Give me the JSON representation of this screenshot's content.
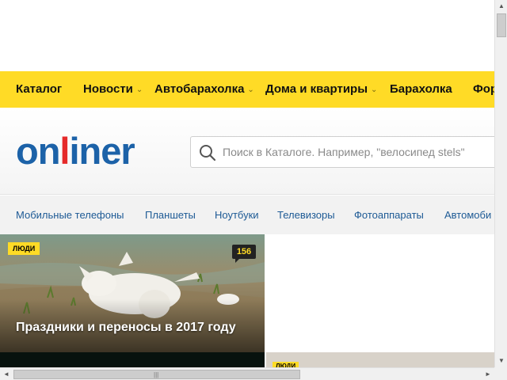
{
  "nav": {
    "items": [
      {
        "label": "Каталог",
        "has_dropdown": false
      },
      {
        "label": "Новости",
        "has_dropdown": true
      },
      {
        "label": "Автобарахолка",
        "has_dropdown": true
      },
      {
        "label": "Дома и квартиры",
        "has_dropdown": true
      },
      {
        "label": "Барахолка",
        "has_dropdown": false
      },
      {
        "label": "Фор",
        "has_dropdown": false
      }
    ],
    "dropdown_glyph": "⌄",
    "background_color": "#ffdb26"
  },
  "logo": {
    "part1": "on",
    "part2": "l",
    "part3": "iner",
    "color": "#1c62a8",
    "accent_color": "#e52a2a"
  },
  "search": {
    "placeholder": "Поиск в Каталоге. Например, \"велосипед stels\"",
    "icon": "search-icon"
  },
  "categories": [
    {
      "label": "Мобильные телефоны"
    },
    {
      "label": "Планшеты"
    },
    {
      "label": "Ноутбуки"
    },
    {
      "label": "Телевизоры"
    },
    {
      "label": "Фотоаппараты"
    },
    {
      "label": "Автомоби"
    }
  ],
  "news": {
    "main": {
      "tag": "ЛЮДИ",
      "comments": "156",
      "title": "Праздники и переносы в 2017 году"
    },
    "secondary": {
      "tag": "ЛЮДИ"
    }
  },
  "scrollbars": {
    "up": "▲",
    "down": "▼",
    "left": "◄",
    "right": "►",
    "grip": "|||"
  }
}
